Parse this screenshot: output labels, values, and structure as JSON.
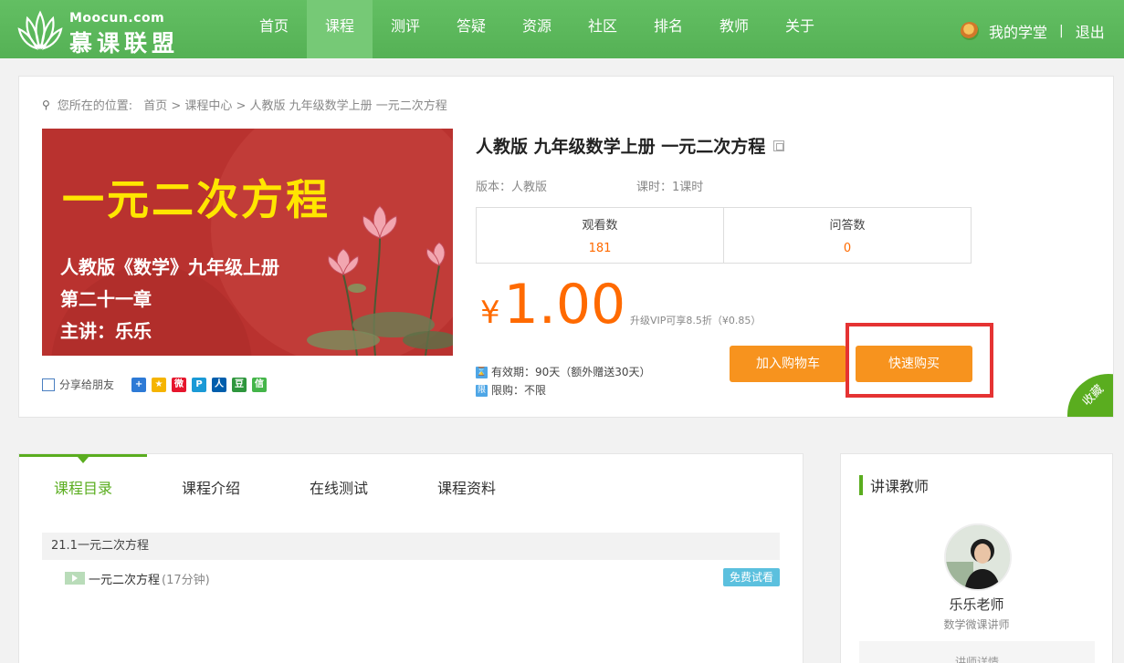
{
  "header": {
    "site": "Moocun.com",
    "brand": "慕课联盟",
    "nav": [
      "首页",
      "课程",
      "测评",
      "答疑",
      "资源",
      "社区",
      "排名",
      "教师",
      "关于"
    ],
    "active_index": 1,
    "my_study": "我的学堂",
    "separator": "|",
    "logout": "退出"
  },
  "breadcrumb": {
    "prefix": "您所在的位置:",
    "path": "首页 > 课程中心 > 人教版 九年级数学上册 一元二次方程"
  },
  "cover": {
    "title": "一元二次方程",
    "line1": "人教版《数学》九年级上册",
    "line2": "第二十一章",
    "line3": "主讲：乐乐"
  },
  "share": {
    "label": "分享给朋友",
    "icons": [
      {
        "name": "share-more-icon",
        "glyph": "+",
        "color": "#2d7ad6"
      },
      {
        "name": "share-qzone-icon",
        "glyph": "★",
        "color": "#f5b400"
      },
      {
        "name": "share-weibo-icon",
        "glyph": "微",
        "color": "#e6162d"
      },
      {
        "name": "share-tqq-icon",
        "glyph": "P",
        "color": "#1b9ad6"
      },
      {
        "name": "share-renren-icon",
        "glyph": "人",
        "color": "#005eac"
      },
      {
        "name": "share-douban-icon",
        "glyph": "豆",
        "color": "#2e963d"
      },
      {
        "name": "share-wechat-icon",
        "glyph": "信",
        "color": "#44b549"
      }
    ]
  },
  "course": {
    "title": "人教版 九年级数学上册 一元二次方程",
    "version": "版本：人教版",
    "hours": "课时：1课时",
    "views_label": "观看数",
    "views": "181",
    "qa_label": "问答数",
    "qa": "0",
    "currency": "¥",
    "price": "1.00",
    "vip_note": "升级VIP可享8.5折（¥0.85）",
    "validity_icon": "⌛",
    "validity": "有效期：90天（额外赠送30天）",
    "limit_icon": "限",
    "limit": "限购：不限",
    "add_cart": "加入购物车",
    "buy_now": "快速购买",
    "favorite": "收藏"
  },
  "tabs": [
    "课程目录",
    "课程介绍",
    "在线测试",
    "课程资料"
  ],
  "catalog": {
    "chapter": "21.1一元二次方程",
    "lesson": "一元二次方程",
    "duration": "(17分钟)",
    "trial": "免费试看"
  },
  "teacher": {
    "heading": "讲课教师",
    "name": "乐乐老师",
    "title": "数学微课讲师",
    "more": "讲师详情"
  },
  "colors": {
    "header_green": "#5cb85c",
    "accent_green": "#5aad1f",
    "orange": "#ff6a00",
    "button_orange": "#f7931e",
    "highlight_red": "#e53333"
  }
}
